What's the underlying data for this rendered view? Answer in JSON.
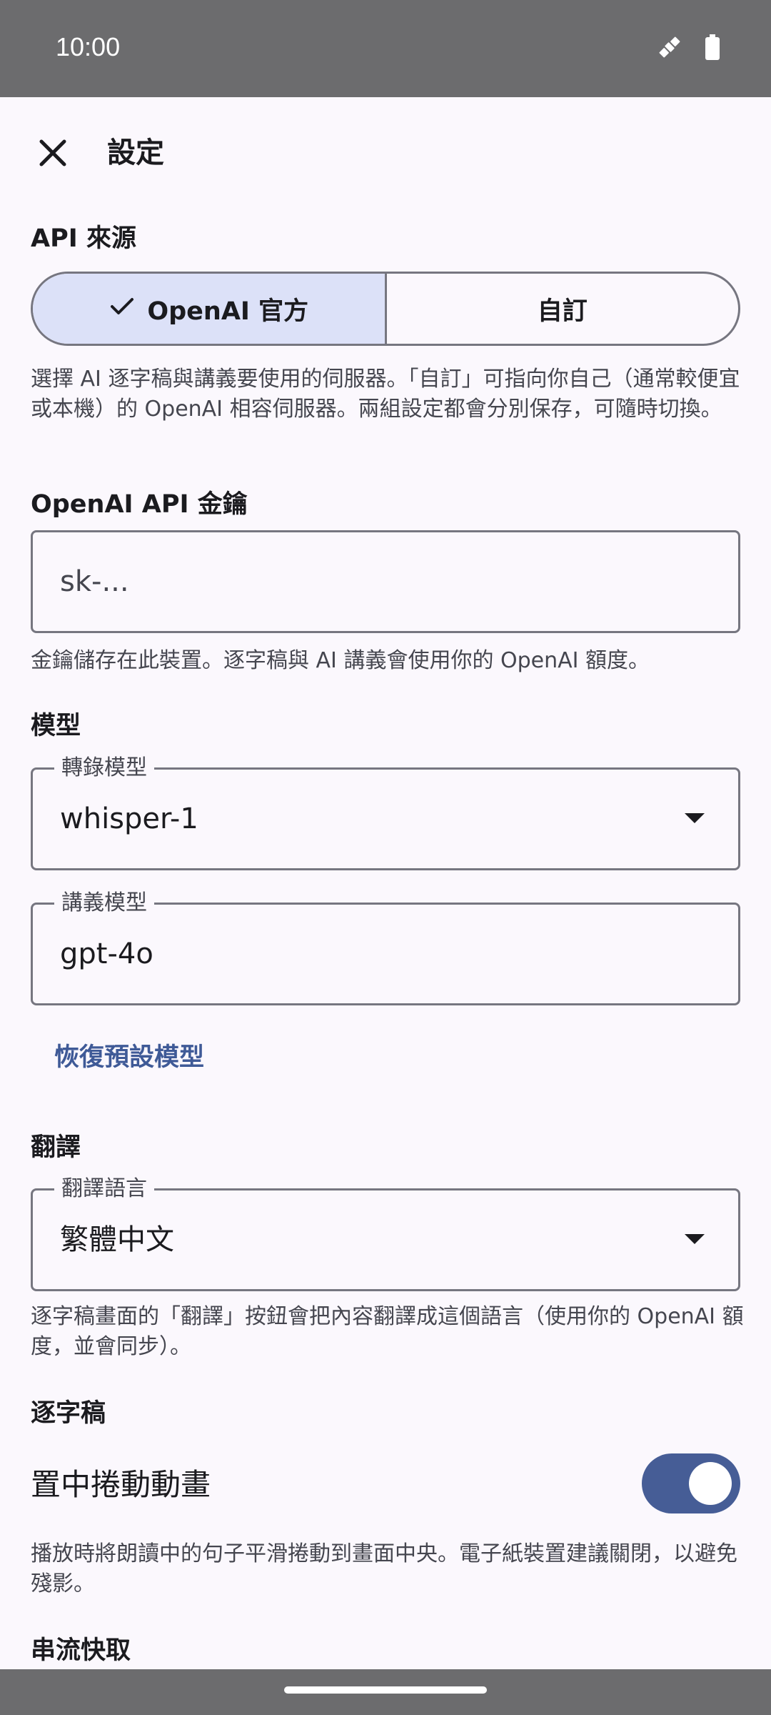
{
  "status_bar": {
    "time": "10:00",
    "icons": [
      "satellite-icon",
      "battery-icon"
    ]
  },
  "header": {
    "title": "設定",
    "close_icon": "close-icon"
  },
  "api_source": {
    "label": "API 來源",
    "options": [
      {
        "label": "OpenAI 官方",
        "selected": true
      },
      {
        "label": "自訂",
        "selected": false
      }
    ],
    "helper": "選擇 AI 逐字稿與講義要使用的伺服器。「自訂」可指向你自己（通常較便宜或本機）的 OpenAI 相容伺服器。兩組設定都會分別保存，可隨時切換。"
  },
  "api_key": {
    "label": "OpenAI API 金鑰",
    "placeholder": "sk-...",
    "helper": "金鑰儲存在此裝置。逐字稿與 AI 講義會使用你的 OpenAI 額度。"
  },
  "models": {
    "label": "模型",
    "transcription": {
      "label": "轉錄模型",
      "value": "whisper-1"
    },
    "notes": {
      "label": "講義模型",
      "value": "gpt-4o"
    },
    "reset_button": "恢復預設模型"
  },
  "translation": {
    "label": "翻譯",
    "language_field_label": "翻譯語言",
    "language_value": "繁體中文",
    "helper": "逐字稿畫面的「翻譯」按鈕會把內容翻譯成這個語言（使用你的 OpenAI 額度，並會同步）。"
  },
  "transcript": {
    "label": "逐字稿",
    "centered_scroll": {
      "label": "置中捲動動畫",
      "enabled": true,
      "helper": "播放時將朗讀中的句子平滑捲動到畫面中央。電子紙裝置建議關閉，以避免殘影。"
    }
  },
  "streaming": {
    "label": "串流快取"
  },
  "colors": {
    "accent": "#465d96",
    "selected_segment": "#dce1f8",
    "link": "#3f5a97"
  }
}
